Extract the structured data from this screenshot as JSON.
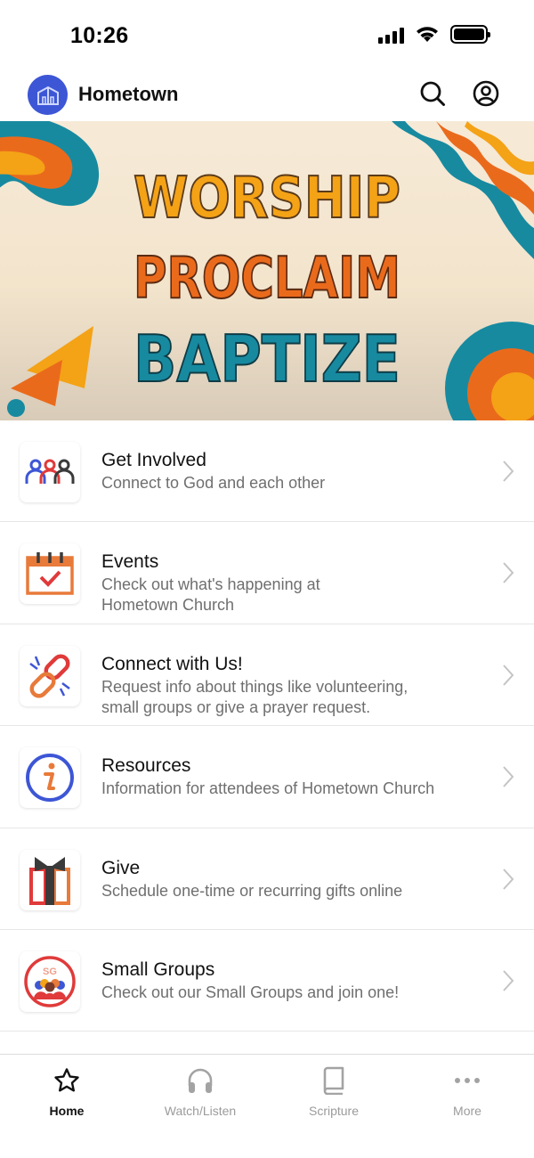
{
  "status_bar": {
    "time": "10:26"
  },
  "header": {
    "title": "Hometown",
    "logo_color": "#3d56d6"
  },
  "banner": {
    "lines": [
      "WORSHIP",
      "PROCLAIM",
      "BAPTIZE"
    ],
    "colors": {
      "line1": "#f4a216",
      "line2": "#ea6a1c",
      "line3": "#178aa0",
      "background": "#f6e9d4"
    }
  },
  "items": [
    {
      "title": "Get Involved",
      "subtitle": "Connect to God and each other",
      "icon": "people-group-icon"
    },
    {
      "title": "Events",
      "subtitle_line1": "Check out what's happening at",
      "subtitle_line2": "Hometown Church",
      "icon": "calendar-check-icon"
    },
    {
      "title": "Connect with Us!",
      "subtitle_line1": "Request info about things like volunteering,",
      "subtitle_line2": "small groups or give a prayer request.",
      "icon": "broken-link-icon"
    },
    {
      "title": "Resources",
      "subtitle": "Information for attendees of Hometown Church",
      "icon": "info-icon"
    },
    {
      "title": "Give",
      "subtitle": "Schedule one-time or recurring gifts online",
      "icon": "gift-icon"
    },
    {
      "title": "Small Groups",
      "subtitle": "Check out our Small Groups and join one!",
      "icon": "small-groups-icon",
      "badge": "SG"
    }
  ],
  "tabs": [
    {
      "label": "Home",
      "icon": "star-icon",
      "active": true
    },
    {
      "label": "Watch/Listen",
      "icon": "headphones-icon",
      "active": false
    },
    {
      "label": "Scripture",
      "icon": "book-icon",
      "active": false
    },
    {
      "label": "More",
      "icon": "more-dots-icon",
      "active": false
    }
  ]
}
